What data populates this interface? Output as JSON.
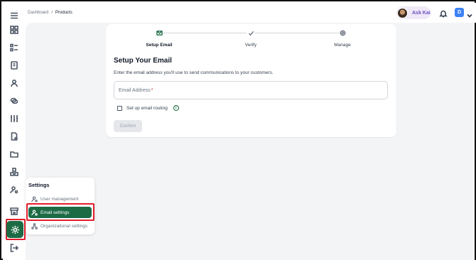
{
  "breadcrumb": {
    "root": "Dashboard",
    "separator": "/",
    "current": "Products"
  },
  "header": {
    "ask_kai_label": "Ask Kai",
    "user_initial": "D"
  },
  "sidebar": {
    "items": [
      {
        "icon": "menu-icon"
      },
      {
        "icon": "grid-icon"
      },
      {
        "icon": "list-icon"
      },
      {
        "icon": "invoice-icon"
      },
      {
        "icon": "person-icon"
      },
      {
        "icon": "coins-icon"
      },
      {
        "icon": "sliders-icon"
      },
      {
        "icon": "document-icon"
      },
      {
        "icon": "folder-icon"
      },
      {
        "icon": "boxes-icon"
      },
      {
        "icon": "user-settings-icon"
      },
      {
        "icon": "store-icon"
      },
      {
        "icon": "gear-icon",
        "active": true
      },
      {
        "icon": "logout-icon"
      }
    ]
  },
  "stepper": {
    "steps": [
      {
        "label": "Setup Email",
        "icon": "mail-icon",
        "active": true
      },
      {
        "label": "Verify",
        "icon": "check-icon",
        "active": false
      },
      {
        "label": "Manage",
        "icon": "gear-icon",
        "active": false
      }
    ]
  },
  "form": {
    "title": "Setup Your Email",
    "description": "Enter the email address you'll use to send communications to your customers.",
    "email_placeholder": "Email Address",
    "required_mark": "*",
    "routing_label": "Set up email routing",
    "info_glyph": "i",
    "confirm_label": "Confirm"
  },
  "settings_menu": {
    "title": "Settings",
    "items": [
      {
        "label": "User management",
        "icon": "user-management-icon",
        "active": false
      },
      {
        "label": "Email settings",
        "icon": "email-settings-icon",
        "active": true
      },
      {
        "label": "Organizational settings",
        "icon": "org-settings-icon",
        "active": false
      }
    ]
  },
  "colors": {
    "accent": "#1c6b45",
    "highlight": "#e11d2a",
    "askkai_bg": "#efe9f7",
    "user_badge": "#3b82f6"
  }
}
